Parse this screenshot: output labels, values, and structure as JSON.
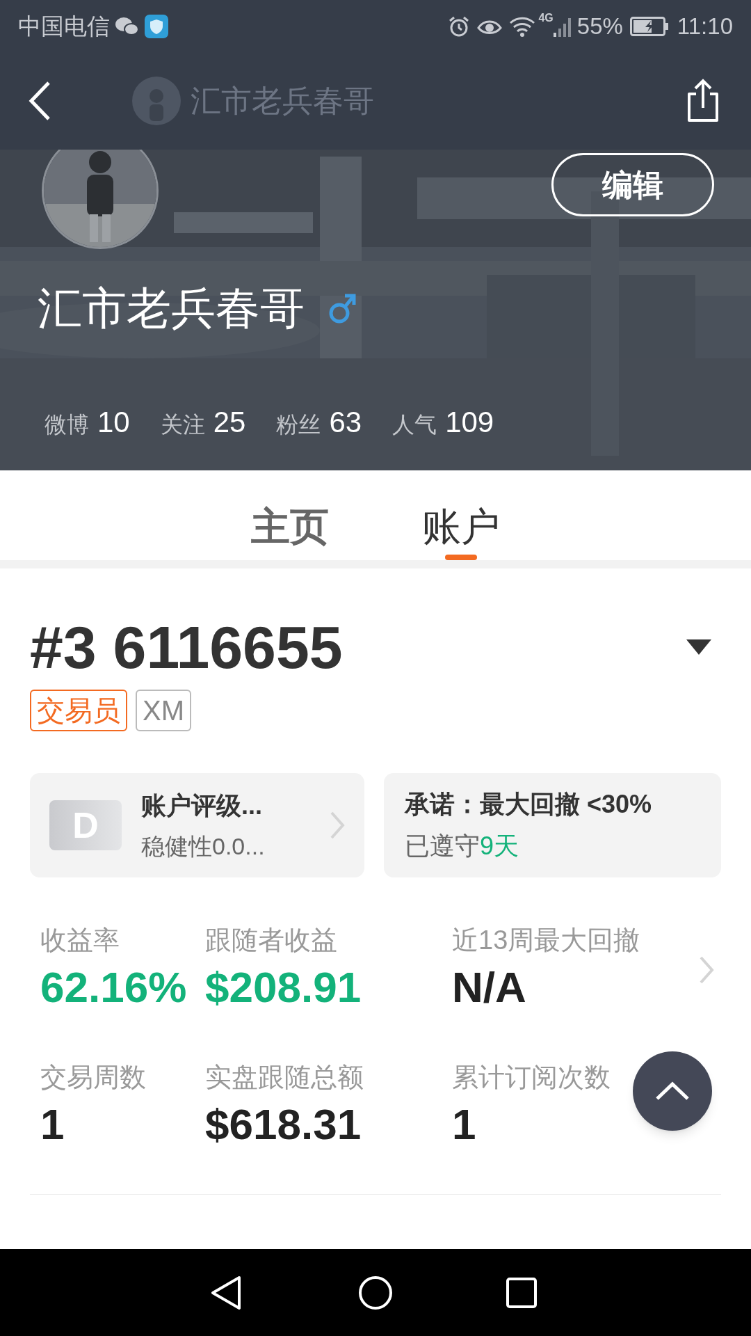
{
  "status_bar": {
    "carrier": "中国电信",
    "network": "4G",
    "battery": "55%",
    "time": "11:10"
  },
  "toolbar": {
    "title": "汇市老兵春哥"
  },
  "profile": {
    "name": "汇市老兵春哥",
    "edit_button": "编辑",
    "stats": [
      {
        "label": "微博",
        "value": "10"
      },
      {
        "label": "关注",
        "value": "25"
      },
      {
        "label": "粉丝",
        "value": "63"
      },
      {
        "label": "人气",
        "value": "109"
      }
    ]
  },
  "tabs": [
    {
      "label": "主页",
      "selected": false
    },
    {
      "label": "账户",
      "selected": true
    }
  ],
  "account": {
    "number": "#3 6116655",
    "tags": [
      {
        "label": "交易员",
        "kind": "primary"
      },
      {
        "label": "XM",
        "kind": "plain"
      }
    ]
  },
  "cards": {
    "rating": {
      "grade": "D",
      "title": "账户评级...",
      "subtitle": "稳健性0.0..."
    },
    "promise": {
      "title": "承诺：最大回撤 <30%",
      "status": "已遵守",
      "days": "9天"
    }
  },
  "metrics": [
    {
      "label": "收益率",
      "value": "62.16%",
      "color": "#13b27a"
    },
    {
      "label": "跟随者收益",
      "value": "$208.91",
      "color": "#13b27a"
    },
    {
      "label": "近13周最大回撤",
      "value": "N/A",
      "color": "#222222"
    },
    {
      "label": "交易周数",
      "value": "1",
      "color": "#222222"
    },
    {
      "label": "实盘跟随总额",
      "value": "$618.31",
      "color": "#222222"
    },
    {
      "label": "累计订阅次数",
      "value": "1",
      "color": "#222222"
    }
  ]
}
